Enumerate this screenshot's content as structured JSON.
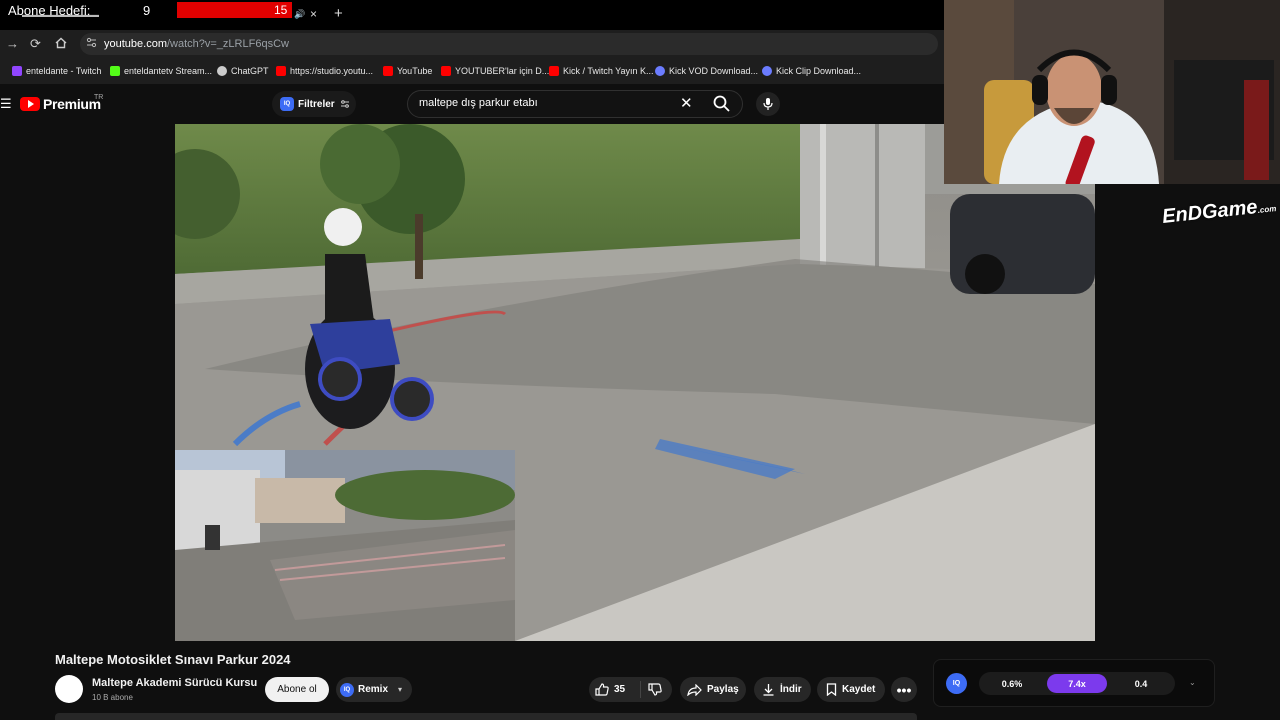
{
  "stream_overlay": {
    "label": "Abone Hedefi:",
    "current": "9",
    "goal": "15",
    "progress_fraction": 0.6
  },
  "browser": {
    "tab_close_glyph": "×",
    "new_tab_glyph": "+",
    "url_host": "youtube.com",
    "url_path": "/watch?v=_zLRLF6qsCw",
    "bookmarks": [
      {
        "label": "enteldante - Twitch",
        "color": "#9146ff"
      },
      {
        "label": "enteldantetv Stream...",
        "color": "#53fc18"
      },
      {
        "label": "ChatGPT",
        "color": "#cccccc"
      },
      {
        "label": "https://studio.youtu...",
        "color": "#ff0000"
      },
      {
        "label": "YouTube",
        "color": "#ff0000"
      },
      {
        "label": "YOUTUBER'lar için D...",
        "color": "#ff0000"
      },
      {
        "label": "Kick / Twitch Yayın K...",
        "color": "#ff0000"
      },
      {
        "label": "Kick VOD Download...",
        "color": "#6b7cff"
      },
      {
        "label": "Kick Clip Download...",
        "color": "#6b7cff"
      }
    ]
  },
  "youtube": {
    "logo_text": "Premium",
    "country": "TR",
    "filter_label": "Filtreler",
    "iq_label": "IQ",
    "search_query": "maltepe dış parkur etabı"
  },
  "stream_logo": {
    "text": "EnDGame",
    "suffix": ".com"
  },
  "video": {
    "title": "Maltepe Motosiklet Sınavı Parkur 2024",
    "channel": "Maltepe Akademi Sürücü Kursu",
    "subscribers": "10 B abone",
    "subscribe_label": "Abone ol",
    "remix_label": "Remix",
    "like_count": "35",
    "share_label": "Paylaş",
    "download_label": "İndir",
    "save_label": "Kaydet"
  },
  "speed_controller": {
    "iq_label": "IQ",
    "values": [
      "0.6%",
      "7.4x",
      "0.4"
    ],
    "active_color": "#7c3aed"
  }
}
